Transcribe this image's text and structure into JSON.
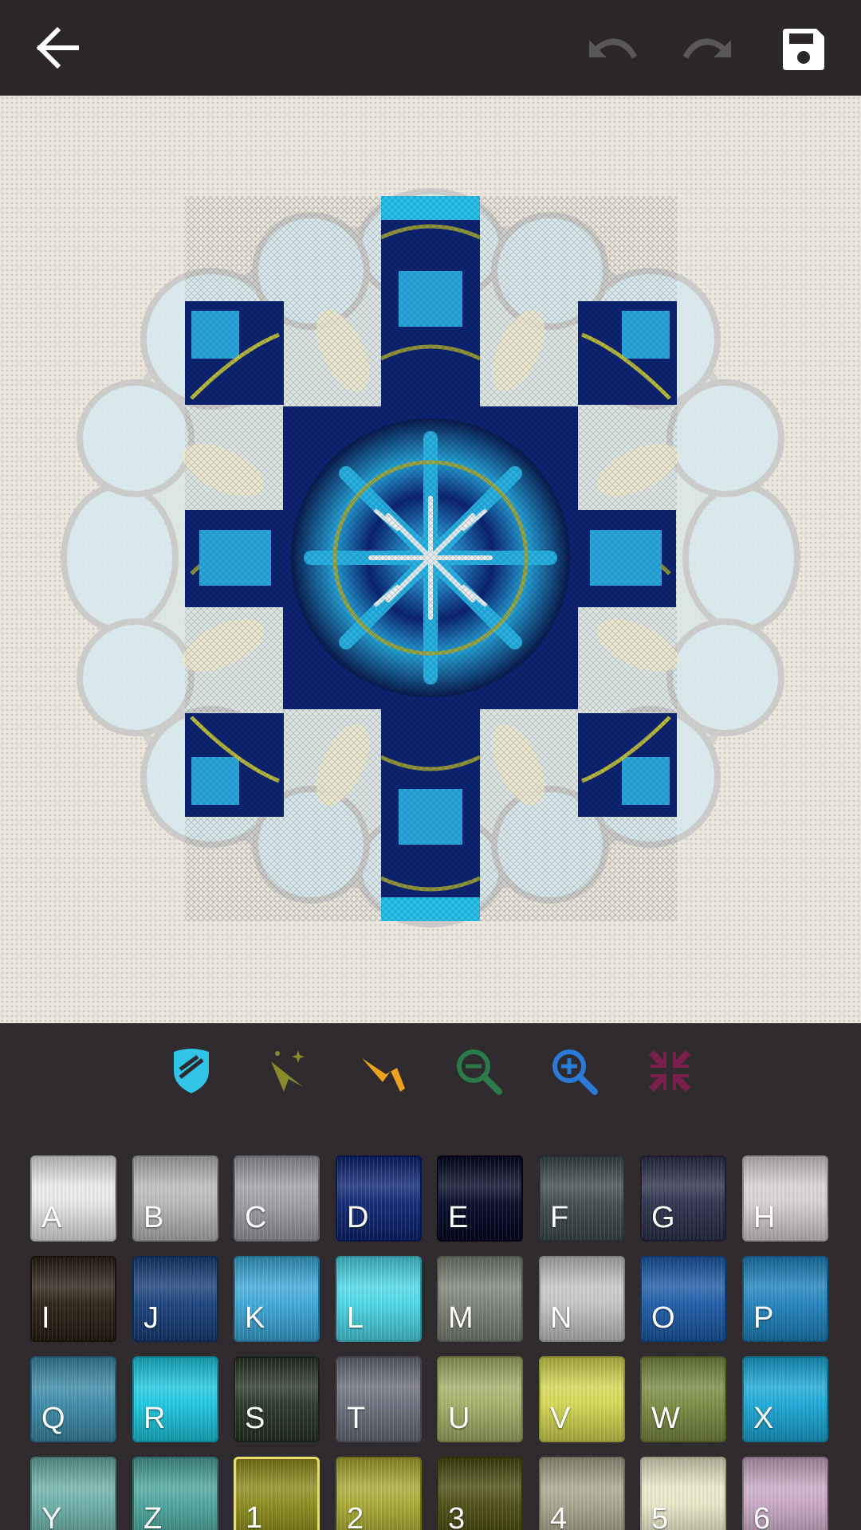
{
  "toolbar": {
    "back_icon": "arrow-left-icon",
    "undo_icon": "undo-icon",
    "redo_icon": "redo-icon",
    "save_icon": "floppy-disk-icon"
  },
  "canvas": {
    "background": "#e9e5dc"
  },
  "tools": [
    {
      "name": "shield-icon",
      "color": "#2fc4e8"
    },
    {
      "name": "magic-wand-icon",
      "color": "#8a8a2a"
    },
    {
      "name": "picker-icon",
      "color": "#f0a020"
    },
    {
      "name": "zoom-out-icon",
      "color": "#2a7a4a"
    },
    {
      "name": "zoom-in-icon",
      "color": "#2a7ad8"
    },
    {
      "name": "fit-screen-icon",
      "color": "#7a1e4a"
    }
  ],
  "swatches": [
    {
      "label": "A",
      "color": "#e8e8e8"
    },
    {
      "label": "B",
      "color": "#b8b8b8"
    },
    {
      "label": "C",
      "color": "#9c9ea4"
    },
    {
      "label": "D",
      "color": "#0c2472"
    },
    {
      "label": "E",
      "color": "#040624"
    },
    {
      "label": "F",
      "color": "#3d4a4c"
    },
    {
      "label": "G",
      "color": "#2c2e4a"
    },
    {
      "label": "H",
      "color": "#d8d0d4"
    },
    {
      "label": "I",
      "color": "#2a1e12"
    },
    {
      "label": "J",
      "color": "#163e7a"
    },
    {
      "label": "K",
      "color": "#3aa8d8"
    },
    {
      "label": "L",
      "color": "#4ad8e8"
    },
    {
      "label": "M",
      "color": "#7c8278"
    },
    {
      "label": "N",
      "color": "#c4c6c4"
    },
    {
      "label": "O",
      "color": "#1a5aa8"
    },
    {
      "label": "P",
      "color": "#1c82be"
    },
    {
      "label": "Q",
      "color": "#3a8aa8"
    },
    {
      "label": "R",
      "color": "#1ac8e0"
    },
    {
      "label": "S",
      "color": "#283428"
    },
    {
      "label": "T",
      "color": "#6a6c7a"
    },
    {
      "label": "U",
      "color": "#a4b066"
    },
    {
      "label": "V",
      "color": "#d6d850"
    },
    {
      "label": "W",
      "color": "#7a8a40"
    },
    {
      "label": "X",
      "color": "#18a8d8"
    },
    {
      "label": "Y",
      "color": "#6ab0a8"
    },
    {
      "label": "Z",
      "color": "#4aa49c"
    },
    {
      "label": "1",
      "color": "#8a8a18",
      "selected": true
    },
    {
      "label": "2",
      "color": "#a8a830"
    },
    {
      "label": "3",
      "color": "#4a4a10"
    },
    {
      "label": "4",
      "color": "#a8a48c"
    },
    {
      "label": "5",
      "color": "#e8e8c8"
    },
    {
      "label": "6",
      "color": "#c8a8c4"
    }
  ]
}
